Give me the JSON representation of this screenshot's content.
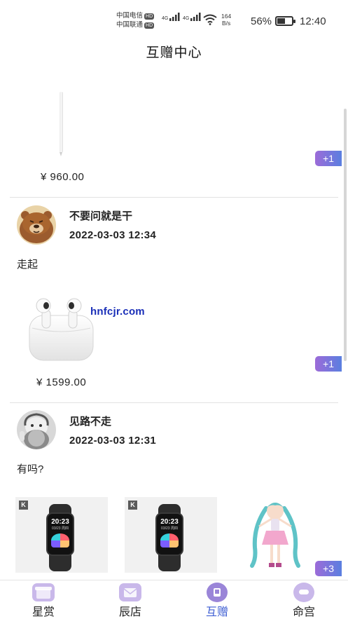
{
  "status_bar": {
    "carrier1": "中国电信",
    "carrier2": "中国联通",
    "hd": "HD",
    "net1": "4G",
    "net2": "4G",
    "speed_value": "164",
    "speed_unit": "B/s",
    "battery": "56%",
    "battery_level": 0.56,
    "time": "12:40"
  },
  "header": {
    "title": "互赠中心"
  },
  "posts": [
    {
      "price": "¥ 960.00",
      "badge": "+1"
    },
    {
      "username": "不要问就是干",
      "time": "2022-03-03 12:34",
      "text": "走起",
      "price": "¥ 1599.00",
      "badge": "+1"
    },
    {
      "username": "见路不走",
      "time": "2022-03-03 12:31",
      "text": "有吗?",
      "badge": "+3",
      "watch_time": "20:23",
      "watch_date": "03/23 周四",
      "thumb_logo": "K"
    }
  ],
  "watermark": "hnfcjr.com",
  "tabs": [
    {
      "label": "星赏",
      "icon": "gift-box-icon"
    },
    {
      "label": "辰店",
      "icon": "mail-icon"
    },
    {
      "label": "互赠",
      "icon": "exchange-icon",
      "active": true
    },
    {
      "label": "命宫",
      "icon": "chat-icon"
    }
  ],
  "colors": {
    "badge_from": "#9c6bd8",
    "badge_to": "#5a7fe0",
    "active_tab": "#3f5fd3",
    "tab_icon": "#c9b8ea"
  }
}
